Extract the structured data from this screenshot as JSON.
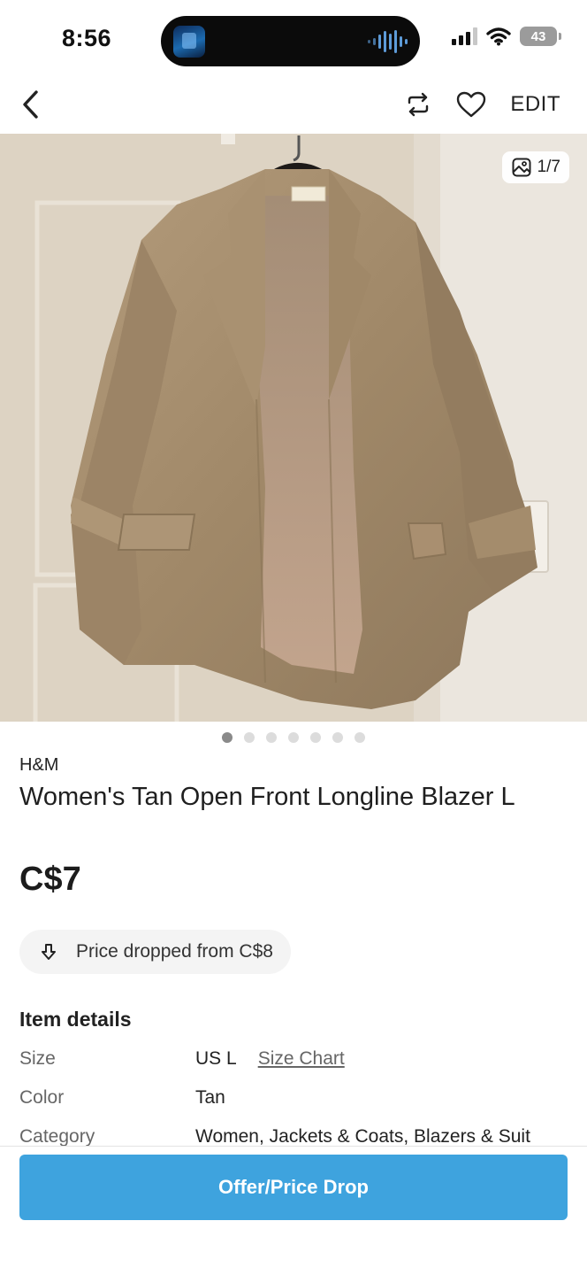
{
  "status_bar": {
    "time": "8:56",
    "battery": "43"
  },
  "nav": {
    "edit_label": "EDIT"
  },
  "photo": {
    "counter": "1/7",
    "total_dots": 7,
    "active_dot": 1
  },
  "listing": {
    "brand": "H&M",
    "title": "Women's Tan Open Front Longline Blazer L",
    "price": "C$7",
    "price_drop": "Price dropped from C$8"
  },
  "details": {
    "heading": "Item details",
    "rows": [
      {
        "label": "Size",
        "value": "US L",
        "link": "Size Chart"
      },
      {
        "label": "Color",
        "value": "Tan"
      },
      {
        "label": "Category",
        "value": "Women, Jackets & Coats, Blazers & Suit"
      }
    ]
  },
  "cta": {
    "label": "Offer/Price Drop"
  },
  "colors": {
    "accent": "#3ea3de",
    "blazer": "#a8906f"
  }
}
